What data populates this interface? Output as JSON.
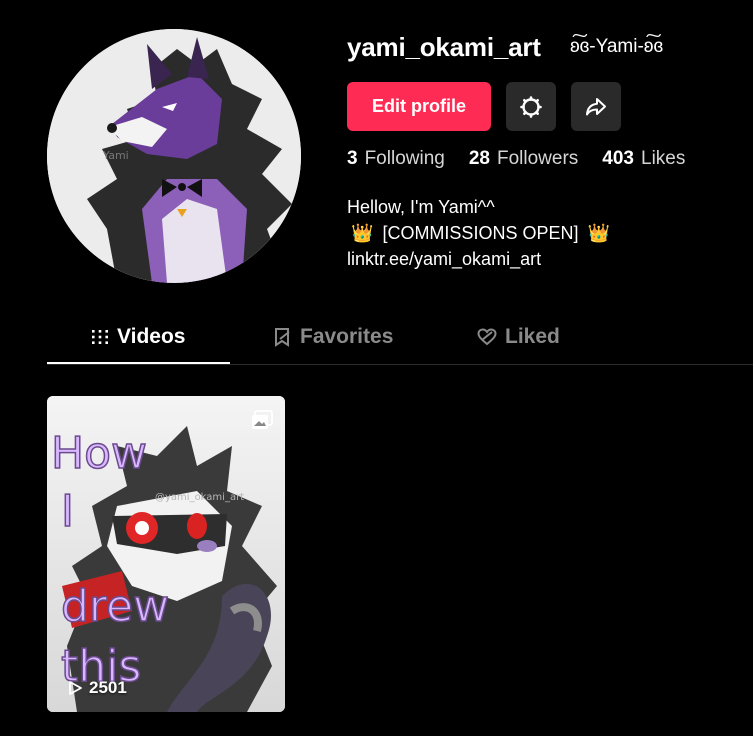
{
  "profile": {
    "username": "yami_okami_art",
    "nickname": "ʚ͠ɞ-Yami-ʚ͠ɞ",
    "edit_label": "Edit profile",
    "settings_icon": "gear-icon",
    "share_icon": "share-arrow-icon"
  },
  "stats": {
    "following_count": "3",
    "following_label": "Following",
    "followers_count": "28",
    "followers_label": "Followers",
    "likes_count": "403",
    "likes_label": "Likes"
  },
  "bio": {
    "line1": "Hellow, I'm Yami^^",
    "crown_left": "👑",
    "line2": "[COMMISSIONS OPEN]",
    "crown_right": "👑",
    "link": "linktr.ee/yami_okami_art"
  },
  "tabs": [
    {
      "label": "Videos",
      "icon": "grid-icon",
      "active": true
    },
    {
      "label": "Favorites",
      "icon": "bookmark-icon",
      "active": false
    },
    {
      "label": "Liked",
      "icon": "heart-icon",
      "active": false
    }
  ],
  "videos": [
    {
      "overlay_text": "How I drew this",
      "watermark": "@yami_okami_art",
      "views": "2501",
      "type_icon": "photo-icon"
    }
  ],
  "colors": {
    "background": "#000000",
    "accent": "#fe2c55",
    "button_dark": "#2a2a2a",
    "inactive_tab": "#8a8a8a"
  }
}
